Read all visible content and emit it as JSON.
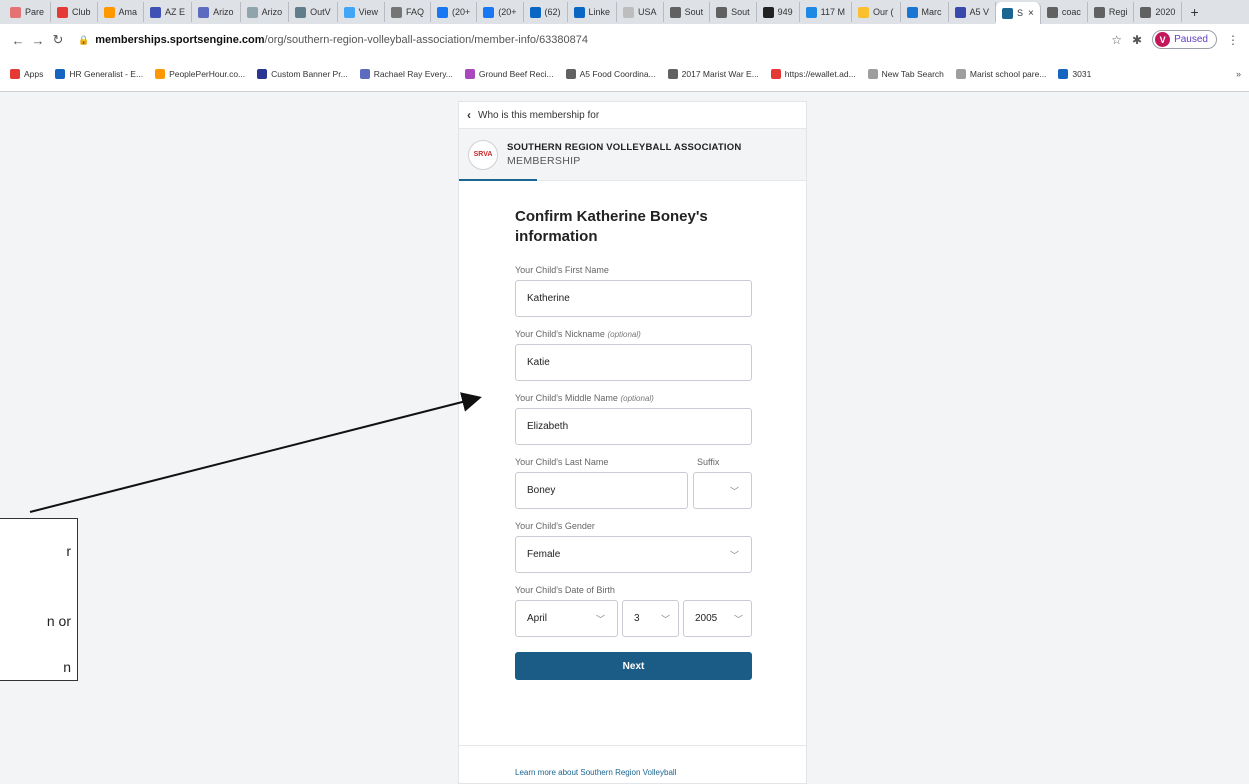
{
  "browser": {
    "tabs": [
      {
        "label": "Pare",
        "color": "#e57373"
      },
      {
        "label": "Club",
        "color": "#e53935"
      },
      {
        "label": "Ama",
        "color": "#ff9800"
      },
      {
        "label": "AZ E",
        "color": "#3f51b5"
      },
      {
        "label": "Arizo",
        "color": "#5c6bc0"
      },
      {
        "label": "Arizo",
        "color": "#90a4ae"
      },
      {
        "label": "OutV",
        "color": "#607d8b"
      },
      {
        "label": "View",
        "color": "#42a5f5"
      },
      {
        "label": "FAQ",
        "color": "#757575"
      },
      {
        "label": "(20+",
        "color": "#1877f2"
      },
      {
        "label": "(20+",
        "color": "#1877f2"
      },
      {
        "label": "(62)",
        "color": "#0a66c2"
      },
      {
        "label": "Linke",
        "color": "#0a66c2"
      },
      {
        "label": "USA",
        "color": "#bdbdbd"
      },
      {
        "label": "Sout",
        "color": "#616161"
      },
      {
        "label": "Sout",
        "color": "#616161"
      },
      {
        "label": "949",
        "color": "#212121"
      },
      {
        "label": "117 M",
        "color": "#1e88e5"
      },
      {
        "label": "Our (",
        "color": "#fbc02d"
      },
      {
        "label": "Marc",
        "color": "#1976d2"
      },
      {
        "label": "A5 V",
        "color": "#3949ab"
      },
      {
        "label": "S",
        "color": "#1a6591",
        "active": true
      },
      {
        "label": "coac",
        "color": "#616161"
      },
      {
        "label": "Regi",
        "color": "#616161"
      },
      {
        "label": "2020",
        "color": "#616161"
      }
    ],
    "new_tab": "+",
    "url_host": "memberships.sportsengine.com",
    "url_path": "/org/southern-region-volleyball-association/member-info/63380874",
    "profile_initial": "V",
    "profile_status": "Paused",
    "bookmarks": [
      {
        "label": "Apps",
        "color": "#e53935"
      },
      {
        "label": "HR Generalist - E...",
        "color": "#1565c0"
      },
      {
        "label": "PeoplePerHour.co...",
        "color": "#ff9800"
      },
      {
        "label": "Custom Banner Pr...",
        "color": "#283593"
      },
      {
        "label": "Rachael Ray Every...",
        "color": "#5c6bc0"
      },
      {
        "label": "Ground Beef Reci...",
        "color": "#ab47bc"
      },
      {
        "label": "A5 Food Coordina...",
        "color": "#616161"
      },
      {
        "label": "2017 Marist War E...",
        "color": "#616161"
      },
      {
        "label": "https://ewallet.ad...",
        "color": "#e53935"
      },
      {
        "label": "New Tab Search",
        "color": "#9e9e9e"
      },
      {
        "label": "Marist school pare...",
        "color": "#9e9e9e"
      },
      {
        "label": "3031",
        "color": "#1565c0"
      }
    ],
    "bookmarks_more": "»"
  },
  "panel": {
    "back_label": "Who is this membership for",
    "org_logo": "SRVA",
    "org_name": "SOUTHERN REGION VOLLEYBALL ASSOCIATION",
    "org_sub": "MEMBERSHIP",
    "title": "Confirm Katherine Boney's information",
    "first_name_label": "Your Child's First Name",
    "first_name_value": "Katherine",
    "nickname_label": "Your Child's Nickname",
    "nickname_optional": "(optional)",
    "nickname_value": "Katie",
    "middle_label": "Your Child's Middle Name",
    "middle_optional": "(optional)",
    "middle_value": "Elizabeth",
    "last_label": "Your Child's Last Name",
    "last_value": "Boney",
    "suffix_label": "Suffix",
    "suffix_value": "",
    "gender_label": "Your Child's Gender",
    "gender_value": "Female",
    "dob_label": "Your Child's Date of Birth",
    "dob_month": "April",
    "dob_day": "3",
    "dob_year": "2005",
    "next_label": "Next",
    "learn_more": "Learn more about Southern Region Volleyball"
  },
  "annotation": {
    "lines": [
      "r",
      "n or",
      "n"
    ]
  }
}
